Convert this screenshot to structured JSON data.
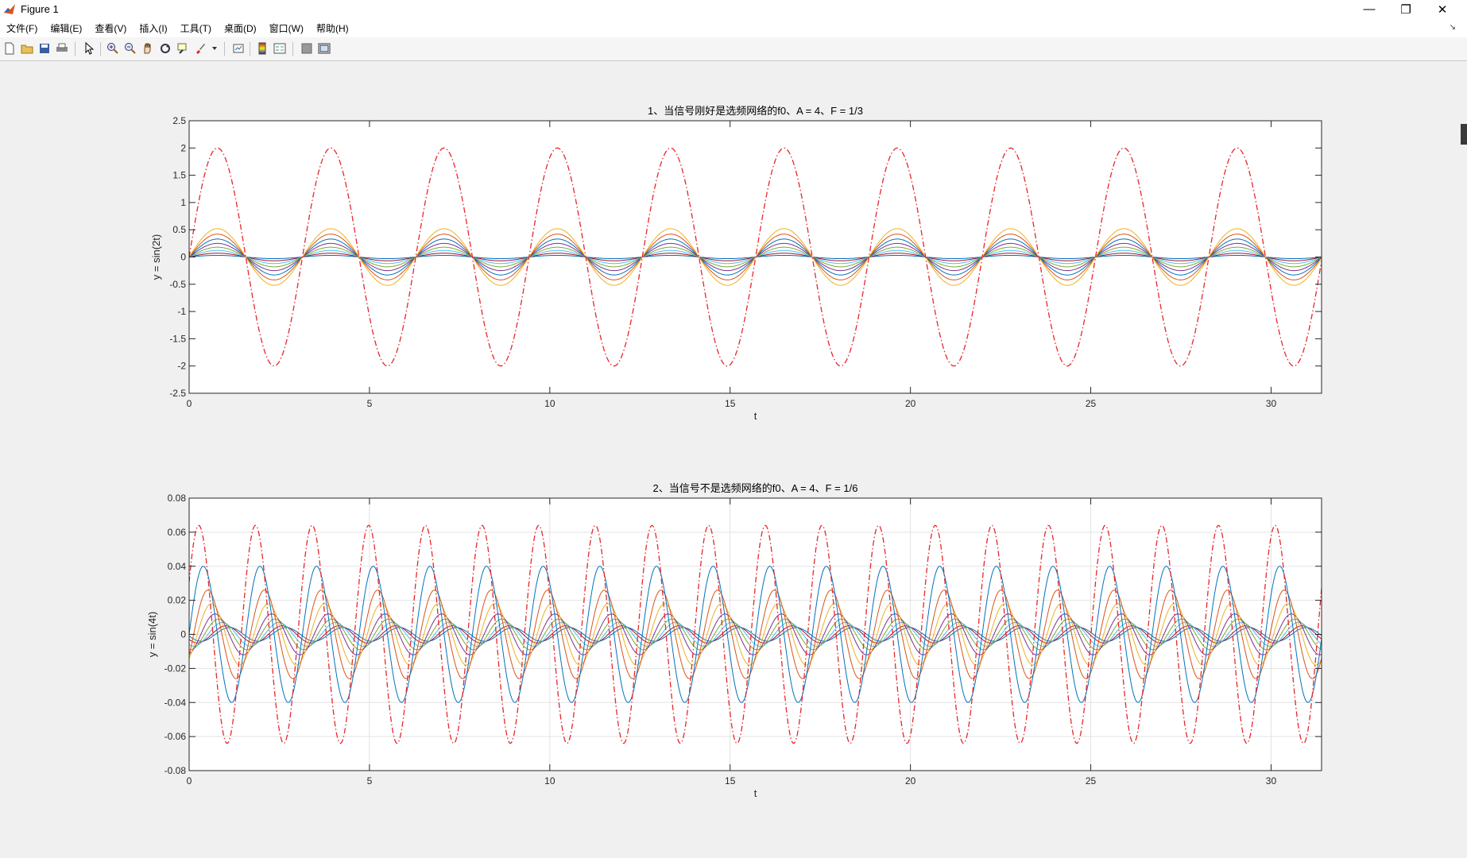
{
  "window": {
    "title": "Figure 1"
  },
  "menu": {
    "items": [
      "文件(F)",
      "编辑(E)",
      "查看(V)",
      "插入(I)",
      "工具(T)",
      "桌面(D)",
      "窗口(W)",
      "帮助(H)"
    ]
  },
  "toolbar": {
    "icons": [
      "new-figure-icon",
      "open-file-icon",
      "save-icon",
      "print-icon",
      "pointer-icon",
      "zoom-in-icon",
      "zoom-out-icon",
      "pan-hand-icon",
      "rotate-3d-icon",
      "data-cursor-icon",
      "brush-icon",
      "brush-dropdown-icon",
      "link-plot-icon",
      "colorbar-icon",
      "legend-icon",
      "hide-plot-tools-icon",
      "show-plot-tools-icon"
    ]
  },
  "colors": {
    "axes_order": [
      "#0072BD",
      "#D95319",
      "#EDB120",
      "#7E2F8E",
      "#77AC30",
      "#4DBEEE",
      "#A2142F"
    ],
    "envelope": "#E8262A",
    "figure_bg": "#f0f0f0"
  },
  "chart_data": [
    {
      "type": "line",
      "title": "1、当信号刚好是选频网络的f0、A = 4、F = 1/3",
      "xlabel": "t",
      "ylabel": "y = sin(2t)",
      "xlim": [
        0,
        31.4
      ],
      "ylim": [
        -2.5,
        2.5
      ],
      "xticks": [
        0,
        5,
        10,
        15,
        20,
        25,
        30
      ],
      "yticks": [
        -2.5,
        -2,
        -1.5,
        -1,
        -0.5,
        0,
        0.5,
        1,
        1.5,
        2,
        2.5
      ],
      "ytick_labels": [
        "-2.5",
        "-2",
        "-1.5",
        "-1",
        "-0.5",
        "0",
        "0.5",
        "1",
        "1.5",
        "2",
        "2.5"
      ],
      "grid": false,
      "series": [
        {
          "function": "sin",
          "omega": 2,
          "phase": 0,
          "amplitude": 2.0,
          "style": "dashdot",
          "color": "#E8262A"
        },
        {
          "function": "sin",
          "omega": 2,
          "phase": 0,
          "amplitude": 0.52,
          "style": "solid",
          "color": "#EDB120"
        },
        {
          "function": "sin",
          "omega": 2,
          "phase": 0,
          "amplitude": 0.42,
          "style": "solid",
          "color": "#D95319"
        },
        {
          "function": "sin",
          "omega": 2,
          "phase": 0,
          "amplitude": 0.33,
          "style": "solid",
          "color": "#0072BD"
        },
        {
          "function": "sin",
          "omega": 2,
          "phase": 0,
          "amplitude": 0.25,
          "style": "solid",
          "color": "#7E2F8E"
        },
        {
          "function": "sin",
          "omega": 2,
          "phase": 0,
          "amplitude": 0.18,
          "style": "solid",
          "color": "#77AC30"
        },
        {
          "function": "sin",
          "omega": 2,
          "phase": 0,
          "amplitude": 0.12,
          "style": "solid",
          "color": "#4DBEEE"
        },
        {
          "function": "sin",
          "omega": 2,
          "phase": 0,
          "amplitude": 0.07,
          "style": "solid",
          "color": "#A2142F"
        },
        {
          "function": "sin",
          "omega": 2,
          "phase": 0,
          "amplitude": 0.03,
          "style": "solid",
          "color": "#0072BD"
        }
      ]
    },
    {
      "type": "line",
      "title": "2、当信号不是选频网络的f0、A = 4、F = 1/6",
      "xlabel": "t",
      "ylabel": "y = sin(4t)",
      "xlim": [
        0,
        31.4
      ],
      "ylim": [
        -0.08,
        0.08
      ],
      "xticks": [
        0,
        5,
        10,
        15,
        20,
        25,
        30
      ],
      "yticks": [
        -0.08,
        -0.06,
        -0.04,
        -0.02,
        0,
        0.02,
        0.04,
        0.06,
        0.08
      ],
      "ytick_labels": [
        "-0.08",
        "-0.06",
        "-0.04",
        "-0.02",
        "0",
        "0.02",
        "0.04",
        "0.06",
        "0.08"
      ],
      "grid": true,
      "series": [
        {
          "function": "sin",
          "omega": 4,
          "phase": 0.5,
          "amplitude": 0.064,
          "style": "dashdot",
          "color": "#E8262A"
        },
        {
          "function": "sin",
          "omega": 4,
          "phase": 0.0,
          "amplitude": 0.04,
          "style": "solid",
          "color": "#0072BD"
        },
        {
          "function": "sin",
          "omega": 4,
          "phase": -0.5,
          "amplitude": 0.026,
          "style": "solid",
          "color": "#D95319"
        },
        {
          "function": "sin",
          "omega": 4,
          "phase": -0.9,
          "amplitude": 0.018,
          "style": "solid",
          "color": "#EDB120"
        },
        {
          "function": "sin",
          "omega": 4,
          "phase": -1.3,
          "amplitude": 0.012,
          "style": "solid",
          "color": "#7E2F8E"
        },
        {
          "function": "sin",
          "omega": 4,
          "phase": -1.7,
          "amplitude": 0.009,
          "style": "solid",
          "color": "#77AC30"
        },
        {
          "function": "sin",
          "omega": 4,
          "phase": -2.1,
          "amplitude": 0.007,
          "style": "solid",
          "color": "#4DBEEE"
        },
        {
          "function": "sin",
          "omega": 4,
          "phase": -2.5,
          "amplitude": 0.005,
          "style": "solid",
          "color": "#A2142F"
        },
        {
          "function": "sin",
          "omega": 4,
          "phase": -2.9,
          "amplitude": 0.004,
          "style": "solid",
          "color": "#0072BD"
        }
      ]
    }
  ]
}
